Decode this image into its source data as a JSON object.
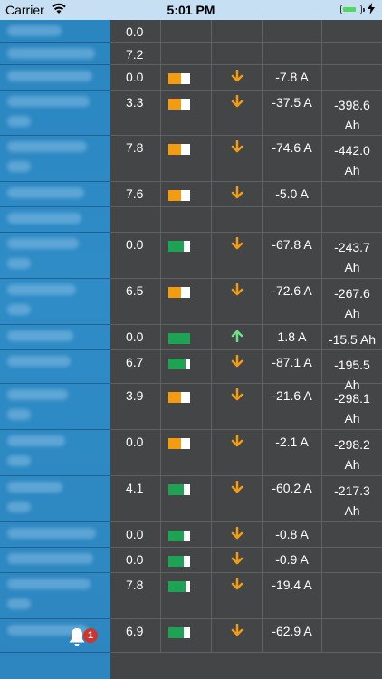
{
  "status_bar": {
    "carrier": "Carrier",
    "time": "5:01 PM",
    "battery_level": 0.8
  },
  "colors": {
    "bar_orange": "#f39c12",
    "bar_green": "#1ea355",
    "arrow_down": "#f39c12",
    "arrow_up": "#6fe08a",
    "sidebar": "#2f8cc6"
  },
  "notification": {
    "icon": "bell-icon",
    "count": "1"
  },
  "rows": [
    {
      "voltage": "0.0",
      "bar": null,
      "arrow": null,
      "current": "",
      "ah1": "",
      "ah2": ""
    },
    {
      "voltage": "7.2",
      "bar": null,
      "arrow": null,
      "current": "",
      "ah1": "",
      "ah2": ""
    },
    {
      "voltage": "0.0",
      "bar": {
        "color": "orange",
        "level": 0.6
      },
      "arrow": "down",
      "current": "-7.8 A",
      "ah1": "",
      "ah2": ""
    },
    {
      "voltage": "3.3",
      "bar": {
        "color": "orange",
        "level": 0.6
      },
      "arrow": "down",
      "current": "-37.5 A",
      "ah1": "-398.6",
      "ah2": "Ah"
    },
    {
      "voltage": "7.8",
      "bar": {
        "color": "orange",
        "level": 0.6
      },
      "arrow": "down",
      "current": "-74.6 A",
      "ah1": "-442.0",
      "ah2": "Ah"
    },
    {
      "voltage": "7.6",
      "bar": {
        "color": "orange",
        "level": 0.6
      },
      "arrow": "down",
      "current": "-5.0 A",
      "ah1": "",
      "ah2": ""
    },
    {
      "voltage": "",
      "bar": null,
      "arrow": null,
      "current": "",
      "ah1": "",
      "ah2": ""
    },
    {
      "voltage": "0.0",
      "bar": {
        "color": "green",
        "level": 0.7
      },
      "arrow": "down",
      "current": "-67.8 A",
      "ah1": "-243.7",
      "ah2": "Ah"
    },
    {
      "voltage": "6.5",
      "bar": {
        "color": "orange",
        "level": 0.6
      },
      "arrow": "down",
      "current": "-72.6 A",
      "ah1": "-267.6",
      "ah2": "Ah"
    },
    {
      "voltage": "0.0",
      "bar": {
        "color": "green",
        "level": 1.0
      },
      "arrow": "up",
      "current": "1.8 A",
      "ah1": "-15.5 Ah",
      "ah2": ""
    },
    {
      "voltage": "6.7",
      "bar": {
        "color": "green",
        "level": 0.8
      },
      "arrow": "down",
      "current": "-87.1 A",
      "ah1": "-195.5",
      "ah2": "Ah"
    },
    {
      "voltage": "3.9",
      "bar": {
        "color": "orange",
        "level": 0.6
      },
      "arrow": "down",
      "current": "-21.6 A",
      "ah1": "-298.1",
      "ah2": "Ah"
    },
    {
      "voltage": "0.0",
      "bar": {
        "color": "orange",
        "level": 0.6
      },
      "arrow": "down",
      "current": "-2.1 A",
      "ah1": "-298.2",
      "ah2": "Ah"
    },
    {
      "voltage": "4.1",
      "bar": {
        "color": "green",
        "level": 0.7
      },
      "arrow": "down",
      "current": "-60.2 A",
      "ah1": "-217.3",
      "ah2": "Ah"
    },
    {
      "voltage": "0.0",
      "bar": {
        "color": "green",
        "level": 0.7
      },
      "arrow": "down",
      "current": "-0.8 A",
      "ah1": "",
      "ah2": ""
    },
    {
      "voltage": "0.0",
      "bar": {
        "color": "green",
        "level": 0.7
      },
      "arrow": "down",
      "current": "-0.9 A",
      "ah1": "",
      "ah2": ""
    },
    {
      "voltage": "7.8",
      "bar": {
        "color": "green",
        "level": 0.8
      },
      "arrow": "down",
      "current": "-19.4 A",
      "ah1": "",
      "ah2": ""
    },
    {
      "voltage": "6.9",
      "bar": {
        "color": "green",
        "level": 0.7
      },
      "arrow": "down",
      "current": "-62.9 A",
      "ah1": "",
      "ah2": ""
    }
  ]
}
